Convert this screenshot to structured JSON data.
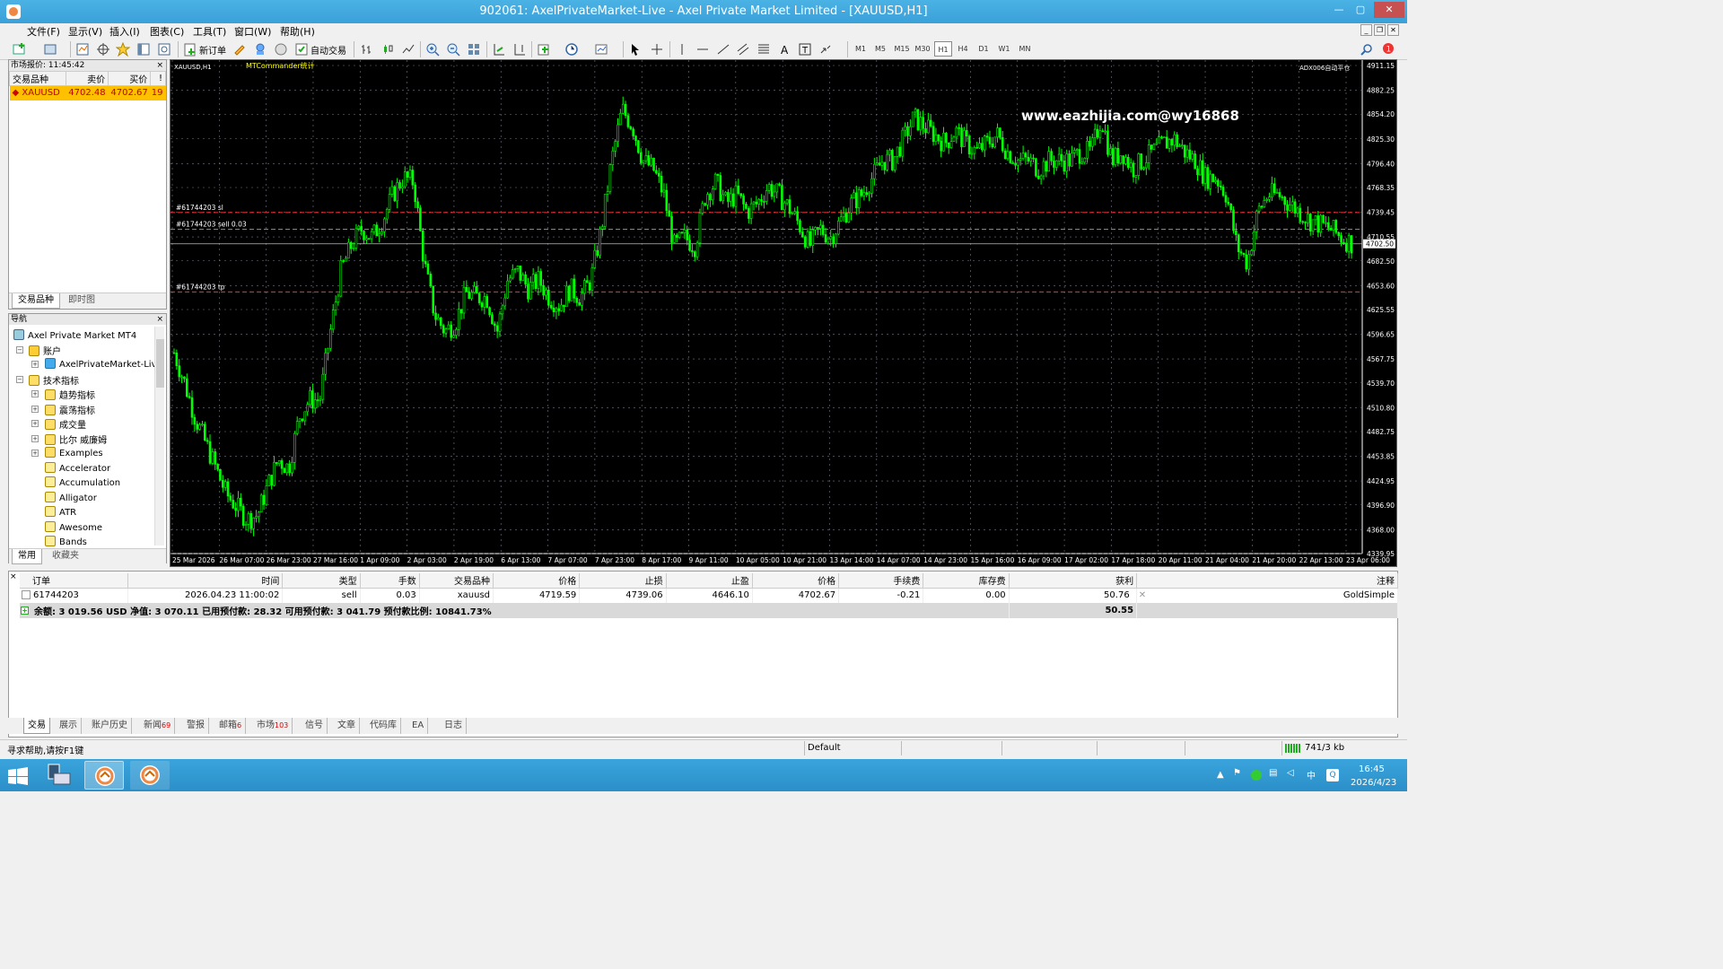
{
  "window": {
    "title": "902061: AxelPrivateMarket-Live - Axel Private Market Limited - [XAUUSD,H1]"
  },
  "menu": [
    "文件(F)",
    "显示(V)",
    "插入(I)",
    "图表(C)",
    "工具(T)",
    "窗口(W)",
    "帮助(H)"
  ],
  "toolbar": {
    "new_order": "新订单",
    "auto_trade": "自动交易",
    "timeframes": [
      "M1",
      "M5",
      "M15",
      "M30",
      "H1",
      "H4",
      "D1",
      "W1",
      "MN"
    ],
    "active_tf": "H1",
    "notif_count": "1"
  },
  "market_watch": {
    "title": "市场报价: 11:45:42",
    "columns": [
      "交易品种",
      "卖价",
      "买价",
      "!"
    ],
    "rows": [
      {
        "symbol": "XAUUSD",
        "bid": "4702.48",
        "ask": "4702.67",
        "spread": "19"
      }
    ],
    "tabs": [
      "交易品种",
      "即时图"
    ]
  },
  "navigator": {
    "title": "导航",
    "root": "Axel Private Market MT4",
    "accounts": "账户",
    "account_item": "AxelPrivateMarket-Liv",
    "indicators": "技术指标",
    "folders": [
      "趋势指标",
      "震荡指标",
      "成交量",
      "比尔 威廉姆",
      "Examples"
    ],
    "items": [
      "Accelerator",
      "Accumulation",
      "Alligator",
      "ATR",
      "Awesome",
      "Bands"
    ],
    "tabs": [
      "常用",
      "收藏夹"
    ]
  },
  "chart": {
    "symbol_label": "XAUUSD,H1",
    "ea_label": "MTCommander统计",
    "indicator_label": "ADX006自动平仓",
    "watermark": "www.eazhijia.com@wy16868",
    "order_lines": {
      "sl": "#61744203 sl",
      "entry": "#61744203 sell 0.03",
      "tp": "#61744203 tp"
    },
    "current_price": "4702.50"
  },
  "chart_data": {
    "type": "candlestick",
    "symbol": "XAUUSD",
    "timeframe": "H1",
    "ylim": [
      4339.95,
      4911.15
    ],
    "y_ticks": [
      "4911.15",
      "4882.25",
      "4854.20",
      "4825.30",
      "4796.40",
      "4768.35",
      "4739.45",
      "4710.55",
      "4682.50",
      "4653.60",
      "4625.55",
      "4596.65",
      "4567.75",
      "4539.70",
      "4510.80",
      "4482.75",
      "4453.85",
      "4424.95",
      "4396.90",
      "4368.00",
      "4339.95"
    ],
    "x_ticks": [
      "25 Mar 2026",
      "26 Mar 07:00",
      "26 Mar 23:00",
      "27 Mar 16:00",
      "1 Apr 09:00",
      "2 Apr 03:00",
      "2 Apr 19:00",
      "6 Apr 13:00",
      "7 Apr 07:00",
      "7 Apr 23:00",
      "8 Apr 17:00",
      "9 Apr 11:00",
      "10 Apr 05:00",
      "10 Apr 21:00",
      "13 Apr 14:00",
      "14 Apr 07:00",
      "14 Apr 23:00",
      "15 Apr 16:00",
      "16 Apr 09:00",
      "17 Apr 02:00",
      "17 Apr 18:00",
      "20 Apr 11:00",
      "21 Apr 04:00",
      "21 Apr 20:00",
      "22 Apr 13:00",
      "23 Apr 06:00"
    ],
    "closes": [
      4575,
      4540,
      4500,
      4470,
      4440,
      4410,
      4395,
      4380,
      4385,
      4420,
      4450,
      4440,
      4500,
      4520,
      4520,
      4600,
      4670,
      4700,
      4720,
      4710,
      4730,
      4760,
      4780,
      4775,
      4680,
      4620,
      4600,
      4610,
      4645,
      4640,
      4640,
      4600,
      4660,
      4670,
      4650,
      4660,
      4640,
      4630,
      4650,
      4640,
      4660,
      4720,
      4800,
      4860,
      4840,
      4800,
      4790,
      4760,
      4700,
      4710,
      4700,
      4760,
      4775,
      4750,
      4760,
      4740,
      4750,
      4770,
      4760,
      4745,
      4725,
      4700,
      4720,
      4710,
      4730,
      4750,
      4760,
      4780,
      4800,
      4800,
      4825,
      4850,
      4840,
      4830,
      4820,
      4835,
      4820,
      4810,
      4820,
      4830,
      4810,
      4800,
      4800,
      4790,
      4800,
      4800,
      4800,
      4810,
      4810,
      4850,
      4800,
      4810,
      4790,
      4800,
      4810,
      4820,
      4825,
      4810,
      4800,
      4780,
      4780,
      4760,
      4700,
      4680,
      4740,
      4760,
      4760,
      4750,
      4740,
      4730,
      4725,
      4720,
      4710,
      4703
    ],
    "order_levels": {
      "sl": 4739.06,
      "entry": 4719.59,
      "tp": 4646.1,
      "bid": 4702.5
    }
  },
  "terminal": {
    "columns": [
      "订单",
      "时间",
      "类型",
      "手数",
      "交易品种",
      "价格",
      "止损",
      "止盈",
      "价格",
      "手续费",
      "库存费",
      "获利",
      "注释"
    ],
    "rows": [
      {
        "order": "61744203",
        "time": "2026.04.23 11:00:02",
        "type": "sell",
        "lots": "0.03",
        "symbol": "xauusd",
        "open_price": "4719.59",
        "sl": "4739.06",
        "tp": "4646.10",
        "price": "4702.67",
        "commission": "-0.21",
        "swap": "0.00",
        "profit": "50.76",
        "comment": "GoldSimple"
      }
    ],
    "summary": "余额: 3 019.56 USD  净值: 3 070.11  已用预付款: 28.32  可用预付款: 3 041.79  预付款比例: 10841.73%",
    "summary_profit": "50.55",
    "tabs": [
      {
        "label": "交易"
      },
      {
        "label": "展示"
      },
      {
        "label": "账户历史"
      },
      {
        "label": "新闻",
        "badge": "69"
      },
      {
        "label": "警报"
      },
      {
        "label": "邮箱",
        "badge": "6"
      },
      {
        "label": "市场",
        "badge": "103"
      },
      {
        "label": "信号"
      },
      {
        "label": "文章"
      },
      {
        "label": "代码库"
      },
      {
        "label": "EA"
      },
      {
        "label": "日志"
      }
    ]
  },
  "statusbar": {
    "help": "寻求帮助,请按F1键",
    "profile": "Default",
    "traffic": "741/3 kb"
  },
  "taskbar": {
    "time": "16:45",
    "date": "2026/4/23"
  }
}
